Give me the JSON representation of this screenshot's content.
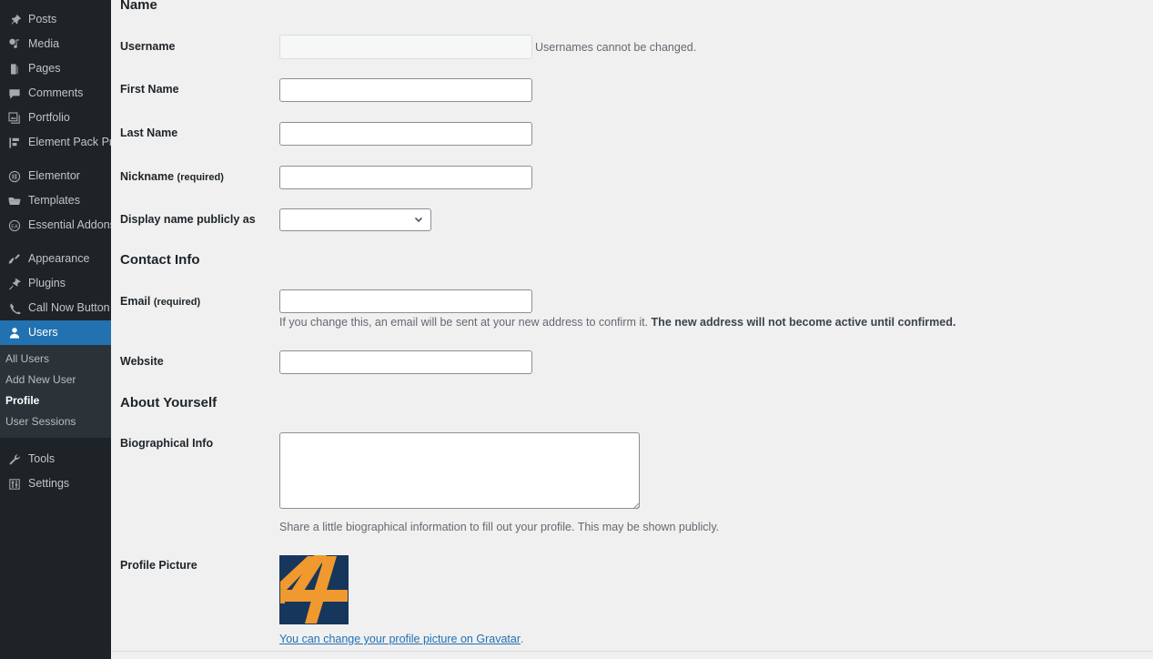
{
  "sidebar": {
    "groups": [
      {
        "items": [
          {
            "label": "Posts",
            "icon": "pin-icon",
            "name": "sidebar-item-posts"
          },
          {
            "label": "Media",
            "icon": "media-icon",
            "name": "sidebar-item-media"
          },
          {
            "label": "Pages",
            "icon": "pages-icon",
            "name": "sidebar-item-pages"
          },
          {
            "label": "Comments",
            "icon": "comment-bubble-icon",
            "name": "sidebar-item-comments"
          },
          {
            "label": "Portfolio",
            "icon": "portfolio-icon",
            "name": "sidebar-item-portfolio"
          },
          {
            "label": "Element Pack Pro",
            "icon": "element-pack-icon",
            "name": "sidebar-item-element-pack-pro"
          }
        ]
      },
      {
        "items": [
          {
            "label": "Elementor",
            "icon": "elementor-circle-icon",
            "name": "sidebar-item-elementor"
          },
          {
            "label": "Templates",
            "icon": "folder-icon",
            "name": "sidebar-item-templates"
          },
          {
            "label": "Essential Addons",
            "icon": "essential-addons-icon",
            "name": "sidebar-item-essential-addons"
          }
        ]
      },
      {
        "items": [
          {
            "label": "Appearance",
            "icon": "paintbrush-icon",
            "name": "sidebar-item-appearance"
          },
          {
            "label": "Plugins",
            "icon": "plug-icon",
            "name": "sidebar-item-plugins"
          },
          {
            "label": "Call Now Button",
            "icon": "phone-icon",
            "name": "sidebar-item-call-now-button"
          },
          {
            "label": "Users",
            "icon": "user-icon",
            "name": "sidebar-item-users",
            "current": true
          }
        ]
      },
      {
        "items": [
          {
            "label": "Tools",
            "icon": "wrench-icon",
            "name": "sidebar-item-tools"
          },
          {
            "label": "Settings",
            "icon": "sliders-icon",
            "name": "sidebar-item-settings"
          }
        ]
      }
    ],
    "users_submenu": [
      {
        "label": "All Users",
        "name": "submenu-item-all-users"
      },
      {
        "label": "Add New User",
        "name": "submenu-item-add-new-user"
      },
      {
        "label": "Profile",
        "name": "submenu-item-profile",
        "current": true
      },
      {
        "label": "User Sessions",
        "name": "submenu-item-user-sessions"
      }
    ]
  },
  "profile": {
    "sections": {
      "name": "Name",
      "contact": "Contact Info",
      "about": "About Yourself"
    },
    "fields": {
      "username": {
        "label": "Username",
        "value": "",
        "note": "Usernames cannot be changed."
      },
      "first_name": {
        "label": "First Name",
        "value": ""
      },
      "last_name": {
        "label": "Last Name",
        "value": ""
      },
      "nickname": {
        "label": "Nickname",
        "required_suffix": "(required)",
        "value": ""
      },
      "display_name": {
        "label": "Display name publicly as",
        "value": "",
        "options": [
          ""
        ]
      },
      "email": {
        "label": "Email",
        "required_suffix": "(required)",
        "value": "",
        "note_plain": "If you change this, an email will be sent at your new address to confirm it. ",
        "note_bold": "The new address will not become active until confirmed."
      },
      "website": {
        "label": "Website",
        "value": ""
      },
      "biographical_info": {
        "label": "Biographical Info",
        "value": "",
        "note": "Share a little biographical information to fill out your profile. This may be shown publicly."
      },
      "profile_picture": {
        "label": "Profile Picture",
        "link_text": "You can change your profile picture on Gravatar",
        "link_trailing": ".",
        "avatar_bg": "#17365c",
        "avatar_fg": "#f0992e"
      }
    }
  },
  "colors": {
    "sidebar_bg": "#1d2327",
    "submenu_bg": "#2c3338",
    "accent": "#2271b1",
    "content_bg": "#f0f0f1",
    "field_border": "#8c8f94"
  }
}
